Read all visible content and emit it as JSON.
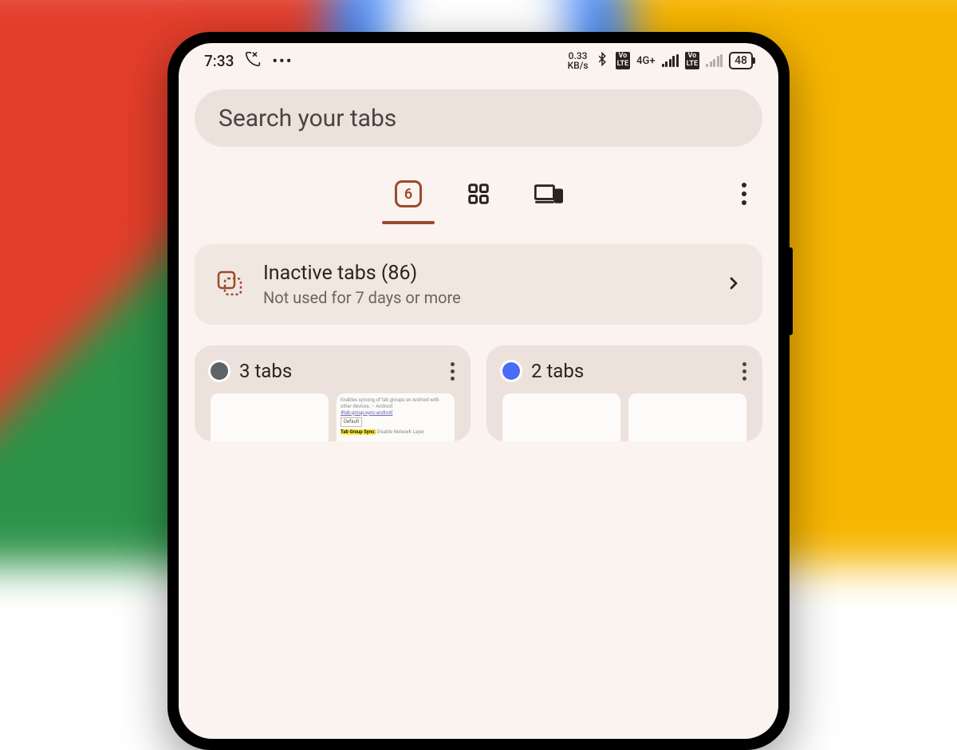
{
  "status": {
    "time": "7:33",
    "data_rate_value": "0.33",
    "data_rate_unit": "KB/s",
    "network_label": "4G+",
    "lte_badge": "Vo\nLTE",
    "battery": "48"
  },
  "search": {
    "placeholder": "Search your tabs"
  },
  "modes": {
    "active_count": "6"
  },
  "inactive": {
    "title": "Inactive tabs (86)",
    "subtitle": "Not used for 7 days or more"
  },
  "groups": [
    {
      "label": "3 tabs",
      "color": "#5f6368"
    },
    {
      "label": "2 tabs",
      "color": "#4a6cf7"
    }
  ],
  "thumb_preview": {
    "line1": "Enables syncing of tab groups on Android with other devices. – Android",
    "line2": "#tab-group-sync-android",
    "select": "Default",
    "line3_hl": "Tab Group Sync:",
    "line3_rest": " Disable Network Layer"
  }
}
